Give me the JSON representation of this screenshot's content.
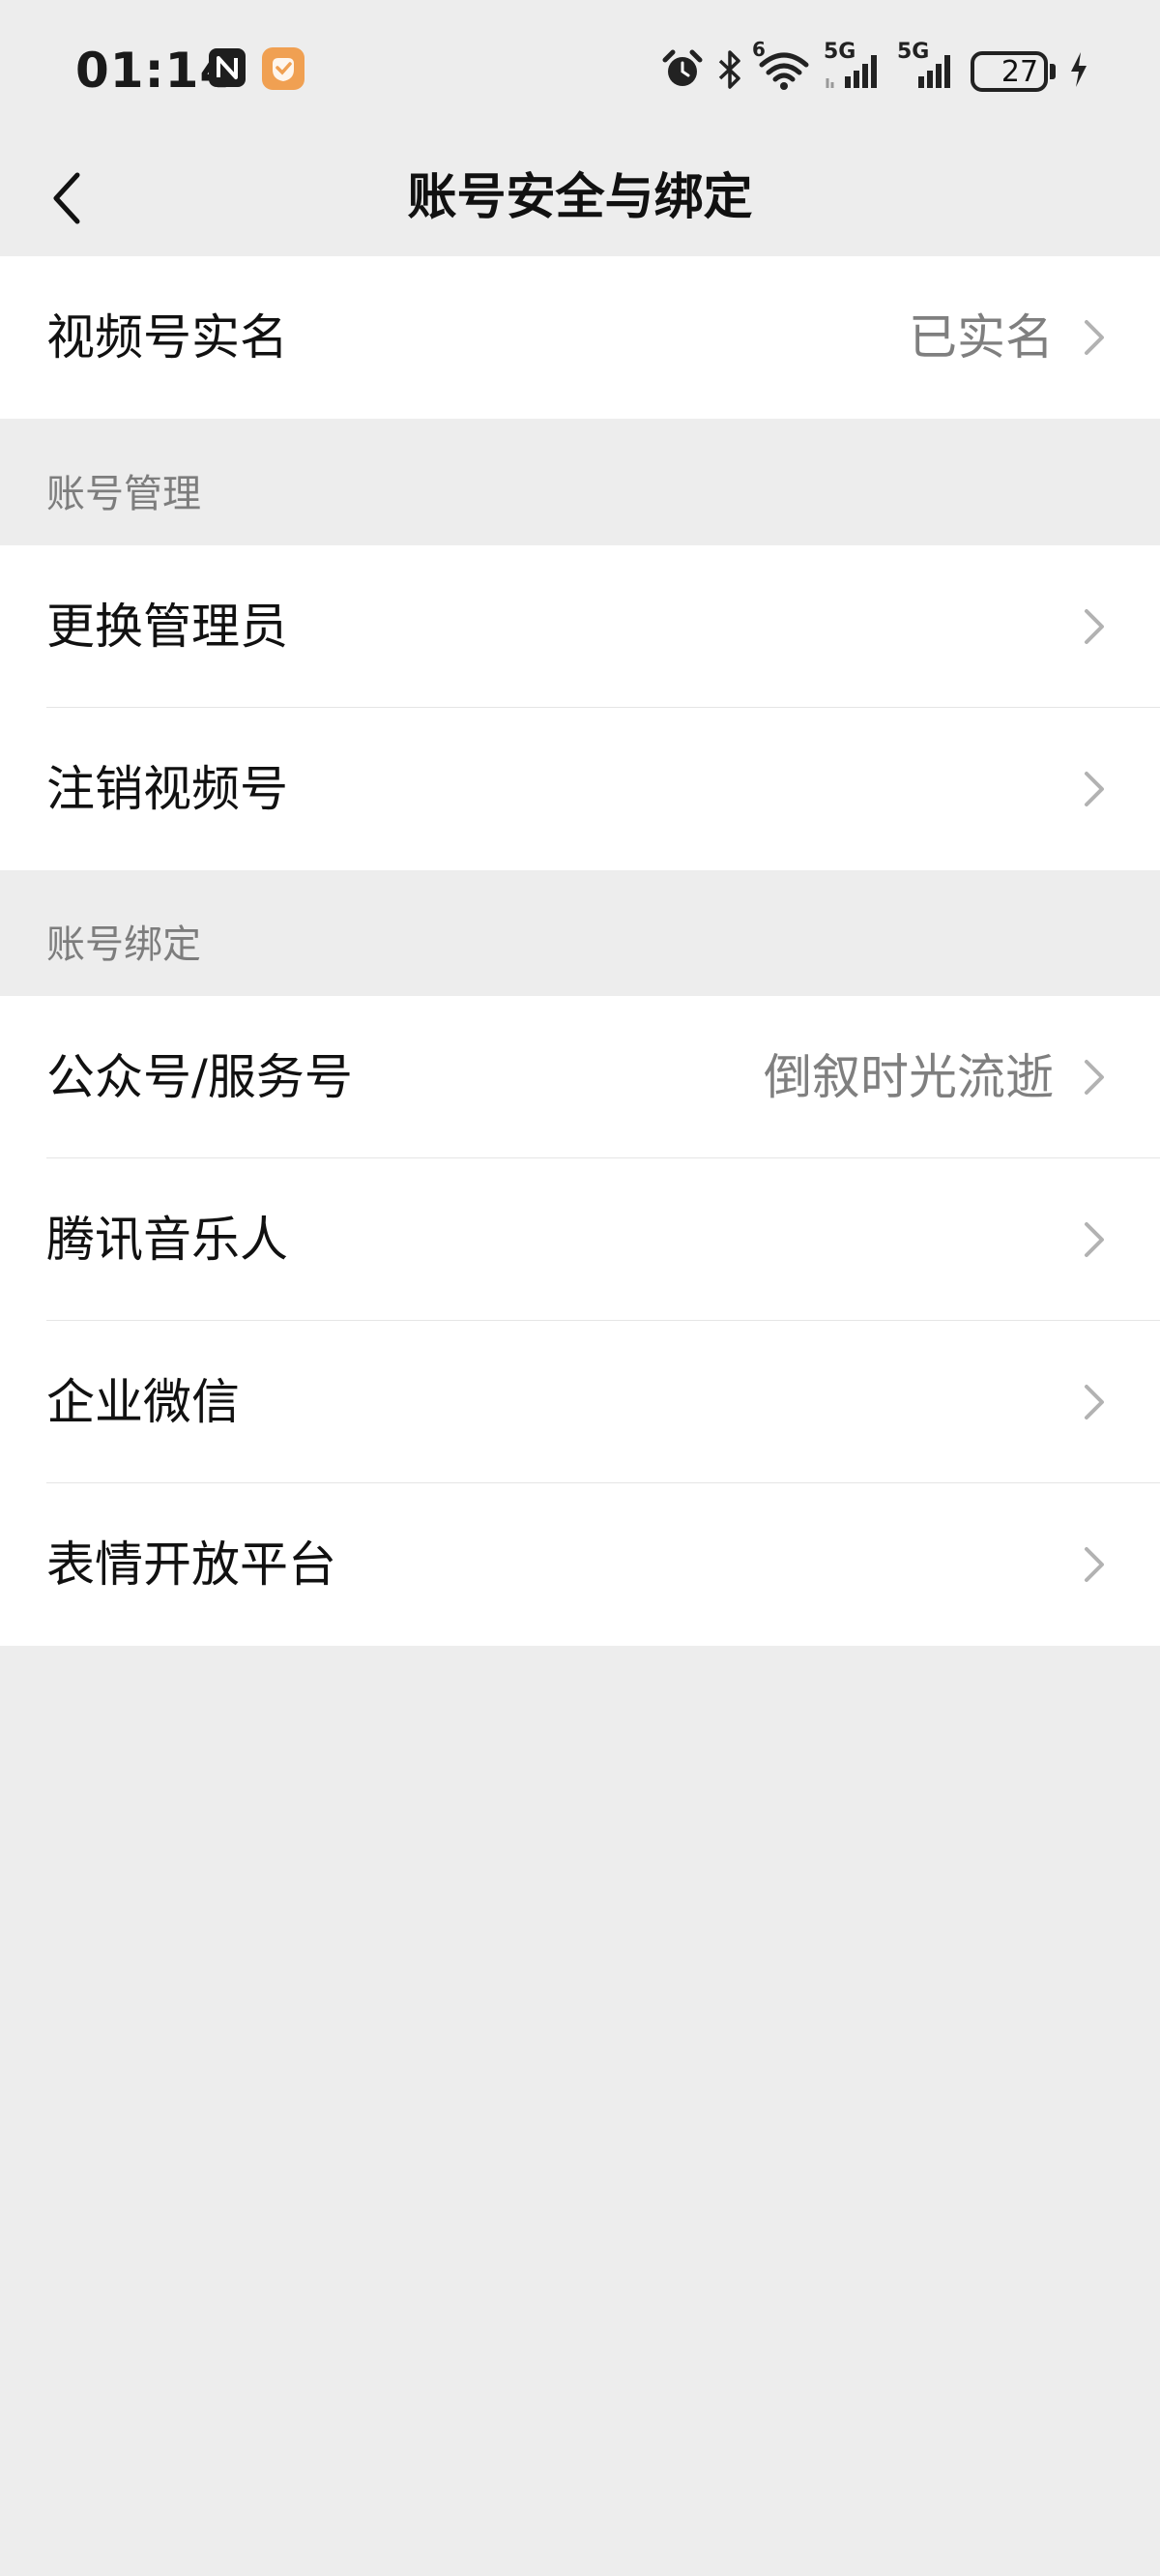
{
  "status_bar": {
    "time": "01:14",
    "battery": "27",
    "icons": [
      "nfc-icon",
      "app-badge-icon",
      "alarm-icon",
      "bluetooth-icon",
      "wifi-icon",
      "signal-5g-icon",
      "signal-5g-icon",
      "charging-icon"
    ],
    "signal_labels": [
      "5G",
      "5G"
    ],
    "wifi_label": "6"
  },
  "nav": {
    "title": "账号安全与绑定"
  },
  "realname": {
    "label": "视频号实名",
    "value": "已实名"
  },
  "account_manage": {
    "header": "账号管理",
    "items": [
      {
        "label": "更换管理员"
      },
      {
        "label": "注销视频号"
      }
    ]
  },
  "account_bind": {
    "header": "账号绑定",
    "items": [
      {
        "label": "公众号/服务号",
        "value": "倒叙时光流逝"
      },
      {
        "label": "腾讯音乐人"
      },
      {
        "label": "企业微信"
      },
      {
        "label": "表情开放平台"
      }
    ]
  },
  "colors": {
    "background": "#ededed",
    "card": "#ffffff",
    "secondary_text": "#7f7f7f",
    "chevron": "#b2b2b2",
    "badge_orange": "#f0a052"
  }
}
